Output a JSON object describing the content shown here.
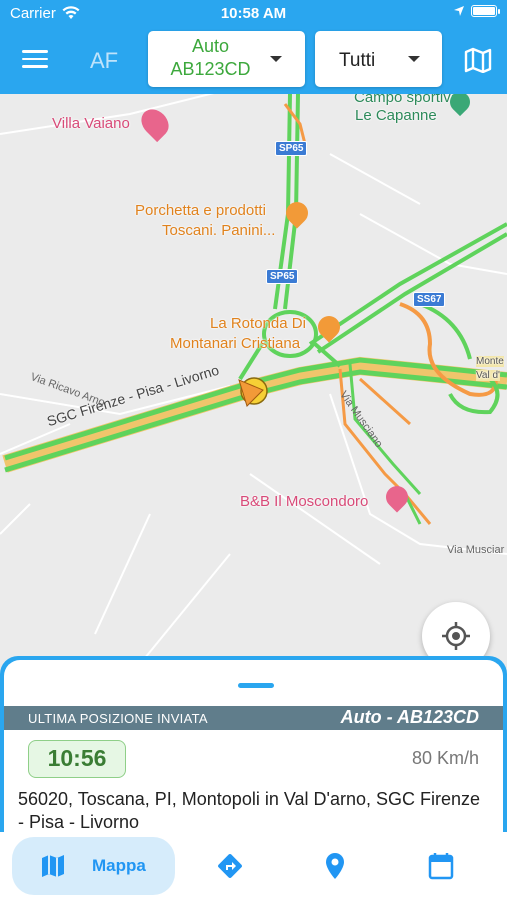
{
  "status_bar": {
    "carrier": "Carrier",
    "time": "10:58 AM"
  },
  "header": {
    "app_title": "AF",
    "vehicle_select": {
      "line1": "Auto",
      "line2": "AB123CD"
    },
    "filter_select": "Tutti"
  },
  "map": {
    "pois": [
      {
        "label": "Villa Vaiano"
      },
      {
        "label": "Campo sportivo"
      },
      {
        "label": "Le Capanne"
      },
      {
        "label": "Porchetta e prodotti"
      },
      {
        "label": "Toscani. Panini..."
      },
      {
        "label": "La Rotonda Di"
      },
      {
        "label": "Montanari Cristiana"
      },
      {
        "label": "B&B Il Moscondoro"
      },
      {
        "label": "Monte"
      },
      {
        "label": "Val d'"
      }
    ],
    "shields": [
      "SP65",
      "SP65",
      "SS67"
    ],
    "streets": [
      "SGC Firenze - Pisa - Livorno",
      "Via Ricavo Arno",
      "Via Musciano",
      "Via Musciar"
    ]
  },
  "sheet": {
    "label": "ULTIMA POSIZIONE INVIATA",
    "vehicle": "Auto - AB123CD",
    "time": "10:56",
    "speed": "80 Km/h",
    "address": "56020, Toscana, PI, Montopoli in Val D'arno, SGC Firenze - Pisa - Livorno"
  },
  "tabbar": {
    "tabs": [
      {
        "label": "Mappa",
        "icon": "map-icon",
        "active": true
      },
      {
        "label": "",
        "icon": "directions-icon"
      },
      {
        "label": "",
        "icon": "location-pin-icon"
      },
      {
        "label": "",
        "icon": "calendar-icon"
      }
    ]
  },
  "colors": {
    "primary": "#2aa6ef",
    "traffic_green": "#5fd35c",
    "traffic_orange": "#f59a45",
    "band": "#607d8b"
  }
}
